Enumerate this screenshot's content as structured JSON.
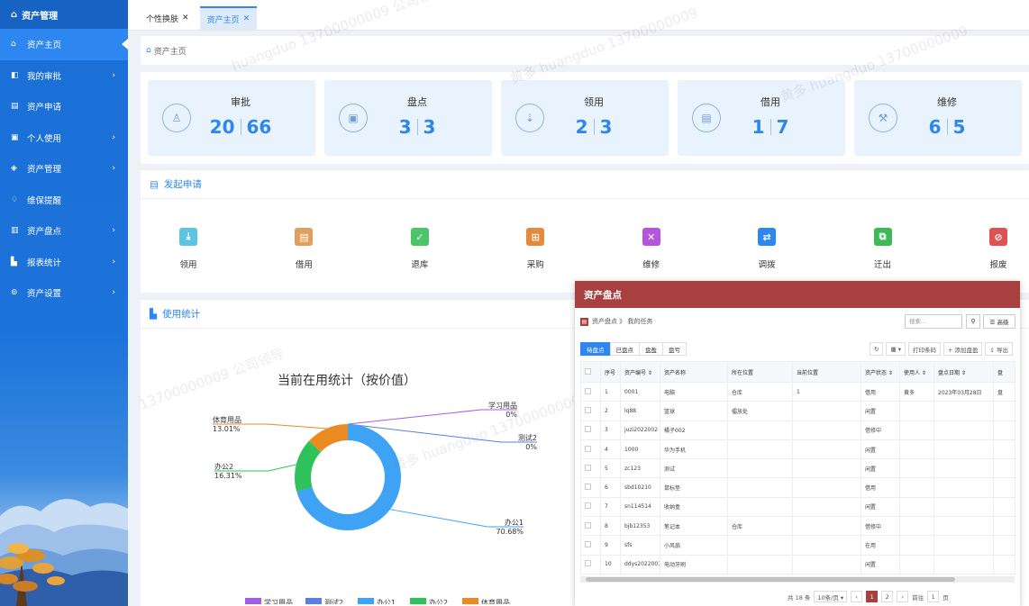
{
  "sidebar": {
    "brand": "资产管理",
    "items": [
      {
        "label": "资产主页",
        "icon": "home-icon",
        "arrow": false,
        "active": true
      },
      {
        "label": "我的审批",
        "icon": "approval-icon",
        "arrow": true
      },
      {
        "label": "资产申请",
        "icon": "document-icon",
        "arrow": false
      },
      {
        "label": "个人使用",
        "icon": "personal-icon",
        "arrow": true
      },
      {
        "label": "资产管理",
        "icon": "layers-icon",
        "arrow": true
      },
      {
        "label": "维保提醒",
        "icon": "bell-icon",
        "arrow": false
      },
      {
        "label": "资产盘点",
        "icon": "inventory-icon",
        "arrow": true
      },
      {
        "label": "报表统计",
        "icon": "report-icon",
        "arrow": true
      },
      {
        "label": "资产设置",
        "icon": "settings-icon",
        "arrow": true
      }
    ]
  },
  "tabs": [
    {
      "label": "个性换肤",
      "close": "✕",
      "active": false
    },
    {
      "label": "资产主页",
      "close": "✕",
      "active": true
    }
  ],
  "breadcrumb": "资产主页",
  "stats": [
    {
      "label": "审批",
      "a": "20",
      "b": "66",
      "icon": "approval-stamp-icon"
    },
    {
      "label": "盘点",
      "a": "3",
      "b": "3",
      "icon": "inventory-box-icon"
    },
    {
      "label": "领用",
      "a": "2",
      "b": "3",
      "icon": "receive-icon"
    },
    {
      "label": "借用",
      "a": "1",
      "b": "7",
      "icon": "borrow-icon"
    },
    {
      "label": "维修",
      "a": "6",
      "b": "5",
      "icon": "wrench-icon"
    }
  ],
  "apply": {
    "title": "发起申请",
    "items": [
      {
        "label": "领用",
        "color": "#5bc4e0",
        "glyph": "⤓"
      },
      {
        "label": "借用",
        "color": "#e0a05c",
        "glyph": "▤"
      },
      {
        "label": "退库",
        "color": "#4cc468",
        "glyph": "✓"
      },
      {
        "label": "采购",
        "color": "#e38a3c",
        "glyph": "⊞"
      },
      {
        "label": "维修",
        "color": "#b455dc",
        "glyph": "✕"
      },
      {
        "label": "调拨",
        "color": "#2e86f0",
        "glyph": "⇄"
      },
      {
        "label": "迁出",
        "color": "#3fb858",
        "glyph": "⧉"
      },
      {
        "label": "报废",
        "color": "#e05252",
        "glyph": "⊘"
      }
    ]
  },
  "usage": {
    "title": "使用统计"
  },
  "chart_data": {
    "type": "pie",
    "title": "当前在用统计（按价值）",
    "slices": [
      {
        "name": "学习用品",
        "value": 0,
        "label": "0%",
        "color": "#a35ee6"
      },
      {
        "name": "测试2",
        "value": 0,
        "label": "0%",
        "color": "#5b7fe0"
      },
      {
        "name": "办公1",
        "value": 70.68,
        "label": "70.68%",
        "color": "#3ea2f5"
      },
      {
        "name": "办公2",
        "value": 16.31,
        "label": "16.31%",
        "color": "#2ec25a"
      },
      {
        "name": "体育用品",
        "value": 13.01,
        "label": "13.01%",
        "color": "#ec8a22"
      }
    ],
    "legend_position": "bottom"
  },
  "watermarks": [
    "13700000009 公司领导",
    "黄多 huangduo 13700000009",
    "huangduo 13700000009 公司领导"
  ],
  "popup": {
    "title": "资产盘点",
    "crumb_root": "资产盘点",
    "crumb_sep": "》",
    "crumb_leaf": "我的任务",
    "search_placeholder": "搜索...",
    "search_icon": "search-icon",
    "advanced": "☰ 高级",
    "tabs": [
      "待盘点",
      "已盘点",
      "盘盈",
      "盘亏"
    ],
    "tools": [
      "↻",
      "▦ ▾",
      "打印条码",
      "+ 添加盘盈",
      "⇪ 导出"
    ],
    "columns": [
      "",
      "序号",
      "资产编号 ⇕",
      "资产名称",
      "所在位置",
      "当前位置",
      "资产状态 ⇕",
      "使用人 ⇕",
      "盘点日期 ⇕",
      "盘"
    ],
    "rows": [
      [
        "1",
        "0001",
        "电脑",
        "仓库",
        "1",
        "借用",
        "黄多",
        "2023年03月28日",
        "盘"
      ],
      [
        "2",
        "lq88",
        "篮球",
        "擂放处",
        "",
        "闲置",
        "",
        "",
        ""
      ],
      [
        "3",
        "juzi2022002",
        "橘子002",
        "",
        "",
        "借修中",
        "",
        "",
        ""
      ],
      [
        "4",
        "1000",
        "华为手机",
        "",
        "",
        "闲置",
        "",
        "",
        ""
      ],
      [
        "5",
        "zc123",
        "测试",
        "",
        "",
        "闲置",
        "",
        "",
        ""
      ],
      [
        "6",
        "sbd10210",
        "鼠标垫",
        "",
        "",
        "借用",
        "",
        "",
        ""
      ],
      [
        "7",
        "sn114514",
        "收纳盒",
        "",
        "",
        "闲置",
        "",
        "",
        ""
      ],
      [
        "8",
        "bjb12353",
        "笔记本",
        "仓库",
        "",
        "借修中",
        "",
        "",
        ""
      ],
      [
        "9",
        "sfs",
        "小风扇",
        "",
        "",
        "在用",
        "",
        "",
        ""
      ],
      [
        "10",
        "ddys2022001",
        "电动牙刷",
        "",
        "",
        "闲置",
        "",
        "",
        ""
      ]
    ],
    "pager": {
      "total": "共 18 条",
      "size": "10条/页 ▾",
      "prev": "‹",
      "pages": [
        "1",
        "2"
      ],
      "next": "›",
      "goto": "前往",
      "page_value": "1",
      "unit": "页"
    }
  }
}
